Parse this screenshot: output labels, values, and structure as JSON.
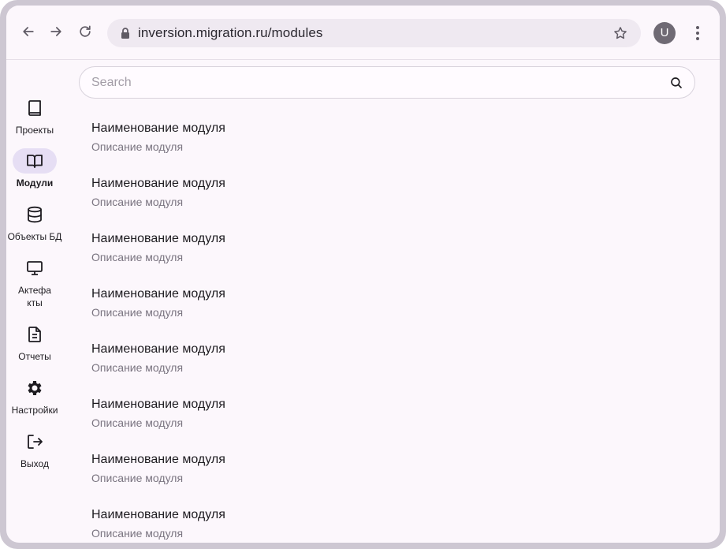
{
  "browser": {
    "url": "inversion.migration.ru/modules",
    "avatar_letter": "U"
  },
  "search": {
    "placeholder": "Search"
  },
  "sidebar": {
    "items": [
      {
        "label": "Проекты",
        "icon": "book-icon",
        "active": false
      },
      {
        "label": "Модули",
        "icon": "open-book-icon",
        "active": true
      },
      {
        "label": "Объекты БД",
        "icon": "database-icon",
        "active": false
      },
      {
        "label": "Актефа\nкты",
        "icon": "monitor-icon",
        "active": false
      },
      {
        "label": "Отчеты",
        "icon": "document-icon",
        "active": false
      },
      {
        "label": "Настройки",
        "icon": "gear-icon",
        "active": false
      },
      {
        "label": "Выход",
        "icon": "logout-icon",
        "active": false
      }
    ]
  },
  "modules": [
    {
      "title": "Наименование модуля",
      "description": "Описание модуля"
    },
    {
      "title": "Наименование модуля",
      "description": "Описание модуля"
    },
    {
      "title": "Наименование модуля",
      "description": "Описание модуля"
    },
    {
      "title": "Наименование модуля",
      "description": "Описание модуля"
    },
    {
      "title": "Наименование модуля",
      "description": "Описание модуля"
    },
    {
      "title": "Наименование модуля",
      "description": "Описание модуля"
    },
    {
      "title": "Наименование модуля",
      "description": "Описание модуля"
    },
    {
      "title": "Наименование модуля",
      "description": "Описание модуля"
    }
  ],
  "colors": {
    "active_nav_bg": "#e6def4",
    "window_bg": "#fcf7fc",
    "frame": "#cdc7d2"
  }
}
